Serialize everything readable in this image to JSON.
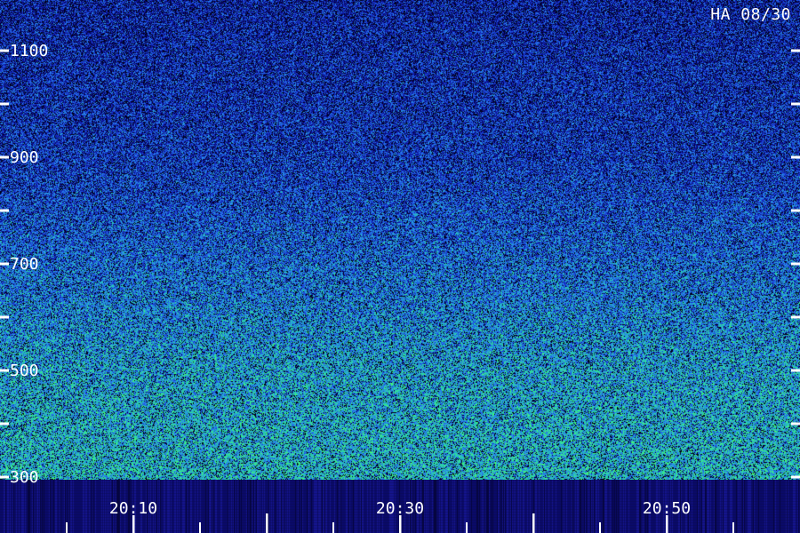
{
  "chart_data": {
    "type": "heatmap",
    "title": "HA 08/30",
    "x_ticks": [
      {
        "label": "20:10",
        "major": true
      },
      {
        "label": "",
        "major": false
      },
      {
        "label": "20:30",
        "major": true
      },
      {
        "label": "",
        "major": false
      },
      {
        "label": "20:50",
        "major": true
      }
    ],
    "x_minor_ticks": [
      "20:05",
      "20:15",
      "20:25",
      "20:35",
      "20:45",
      "20:55"
    ],
    "y_range": [
      300,
      1200
    ],
    "y_ticks": [
      {
        "value": 300,
        "label": "300"
      },
      {
        "value": 400,
        "label": ""
      },
      {
        "value": 500,
        "label": "500"
      },
      {
        "value": 600,
        "label": ""
      },
      {
        "value": 700,
        "label": "700"
      },
      {
        "value": 800,
        "label": ""
      },
      {
        "value": 900,
        "label": "900"
      },
      {
        "value": 1000,
        "label": ""
      },
      {
        "value": 1100,
        "label": "1100"
      }
    ],
    "colormap": [
      "#000010",
      "#0a0a8a",
      "#1a3fd8",
      "#2a8cf0",
      "#25d6a8",
      "#4cff6a"
    ],
    "noise_profile": {
      "description_values": [
        {
          "y": 300,
          "intensity": 0.72
        },
        {
          "y": 500,
          "intensity": 0.66
        },
        {
          "y": 700,
          "intensity": 0.52
        },
        {
          "y": 900,
          "intensity": 0.38
        },
        {
          "y": 1100,
          "intensity": 0.33
        },
        {
          "y": 1200,
          "intensity": 0.3
        }
      ]
    }
  },
  "colors": {
    "background": "#000010",
    "band_background": "#0b0b6a",
    "band_stripe": "#15158f",
    "tick_color": "#ffffff",
    "label_color": "#ffffff"
  }
}
